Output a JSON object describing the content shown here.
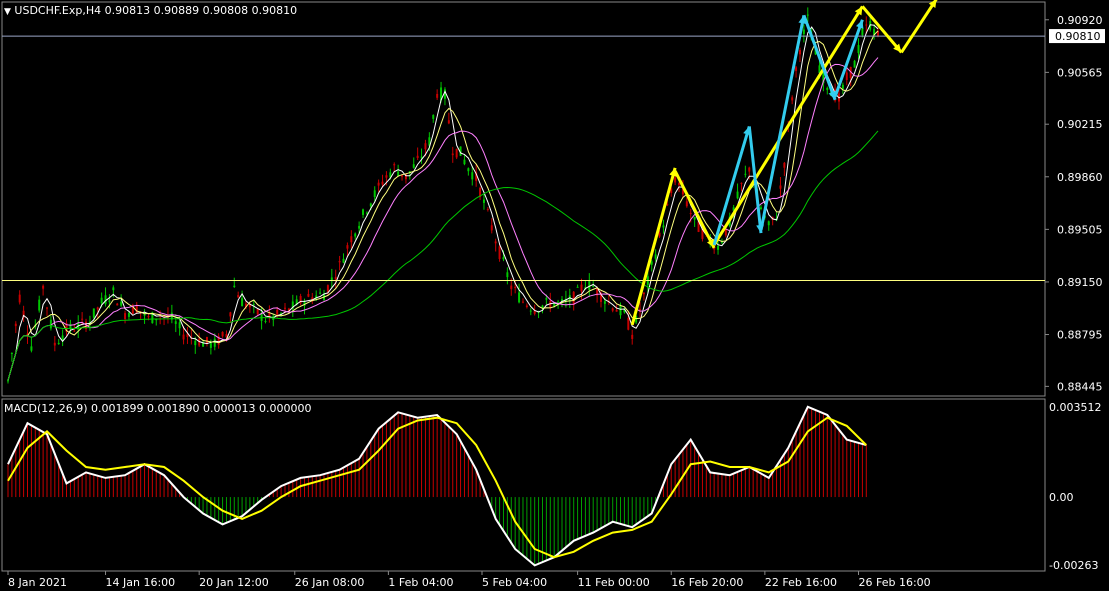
{
  "header": {
    "symbol_line": "USDCHF.Exp,H4  0.90813 0.90889 0.90808 0.90810",
    "macd_line": "MACD(12,26,9) 0.001899 0.001890 0.000013 0.000000"
  },
  "colors": {
    "background": "#000000",
    "bull_candle": "#00c800",
    "bear_candle": "#c80000",
    "ma_fast": "#ffffff",
    "ma_mid": "#ffff80",
    "ma_slow": "#ff80ff",
    "ma_long": "#00c800",
    "price_line": "#9ba6c8",
    "resistance_line": "#ffff80",
    "arrow_yellow": "#ffff00",
    "arrow_cyan": "#33ccee",
    "macd_main": "#ffffff",
    "macd_signal": "#ffff00",
    "hist_pos": "#c80000",
    "hist_neg": "#00a000"
  },
  "chart_data": [
    {
      "type": "candlestick",
      "title": "USDCHF.Exp,H4",
      "ohlc_current": {
        "open": 0.90813,
        "high": 0.90889,
        "low": 0.90808,
        "close": 0.9081
      },
      "current_price_label": "0.90810",
      "ylim": [
        0.8838,
        0.9104
      ],
      "y_ticks": [
        "0.90920",
        "0.90565",
        "0.90215",
        "0.89860",
        "0.89505",
        "0.89150",
        "0.88795",
        "0.88445"
      ],
      "horizontal_line_level": 0.8916,
      "x_tick_labels": [
        "8 Jan 2021",
        "14 Jan 16:00",
        "20 Jan 12:00",
        "26 Jan 08:00",
        "1 Feb 04:00",
        "5 Feb 04:00",
        "11 Feb 00:00",
        "16 Feb 20:00",
        "22 Feb 16:00",
        "26 Feb 16:00"
      ],
      "price_path": [
        [
          0,
          0.8848
        ],
        [
          6,
          0.8905
        ],
        [
          12,
          0.8872
        ],
        [
          18,
          0.8912
        ],
        [
          24,
          0.8873
        ],
        [
          30,
          0.8883
        ],
        [
          36,
          0.8885
        ],
        [
          42,
          0.8889
        ],
        [
          48,
          0.8901
        ],
        [
          54,
          0.8908
        ],
        [
          60,
          0.8894
        ],
        [
          66,
          0.8898
        ],
        [
          72,
          0.889
        ],
        [
          78,
          0.8893
        ],
        [
          84,
          0.889
        ],
        [
          90,
          0.888
        ],
        [
          100,
          0.8874
        ],
        [
          106,
          0.8873
        ],
        [
          112,
          0.888
        ],
        [
          116,
          0.8912
        ],
        [
          120,
          0.8902
        ],
        [
          126,
          0.8896
        ],
        [
          132,
          0.889
        ],
        [
          138,
          0.8892
        ],
        [
          144,
          0.8896
        ],
        [
          150,
          0.8902
        ],
        [
          156,
          0.8905
        ],
        [
          162,
          0.8907
        ],
        [
          170,
          0.8926
        ],
        [
          176,
          0.8945
        ],
        [
          184,
          0.8965
        ],
        [
          192,
          0.8983
        ],
        [
          198,
          0.8992
        ],
        [
          204,
          0.8986
        ],
        [
          210,
          0.8996
        ],
        [
          216,
          0.901
        ],
        [
          220,
          0.9043
        ],
        [
          224,
          0.9041
        ],
        [
          228,
          0.9005
        ],
        [
          232,
          0.9002
        ],
        [
          236,
          0.8992
        ],
        [
          240,
          0.8985
        ],
        [
          246,
          0.896
        ],
        [
          252,
          0.8935
        ],
        [
          258,
          0.8912
        ],
        [
          264,
          0.8902
        ],
        [
          270,
          0.8897
        ],
        [
          278,
          0.8901
        ],
        [
          284,
          0.89
        ],
        [
          290,
          0.8904
        ],
        [
          296,
          0.8914
        ],
        [
          300,
          0.8912
        ],
        [
          304,
          0.8906
        ],
        [
          310,
          0.8899
        ],
        [
          316,
          0.8893
        ],
        [
          320,
          0.888
        ],
        [
          326,
          0.8905
        ],
        [
          332,
          0.8935
        ],
        [
          338,
          0.8965
        ],
        [
          342,
          0.8985
        ],
        [
          346,
          0.8975
        ],
        [
          352,
          0.8955
        ],
        [
          358,
          0.8945
        ],
        [
          364,
          0.8939
        ],
        [
          370,
          0.8955
        ],
        [
          376,
          0.898
        ],
        [
          380,
          0.8992
        ],
        [
          386,
          0.8965
        ],
        [
          390,
          0.8952
        ],
        [
          394,
          0.896
        ],
        [
          398,
          0.8996
        ],
        [
          402,
          0.904
        ],
        [
          406,
          0.9073
        ],
        [
          410,
          0.9092
        ],
        [
          414,
          0.9069
        ],
        [
          418,
          0.9052
        ],
        [
          422,
          0.9045
        ],
        [
          426,
          0.9038
        ],
        [
          430,
          0.9052
        ],
        [
          434,
          0.9062
        ],
        [
          438,
          0.9083
        ],
        [
          442,
          0.9089
        ],
        [
          446,
          0.9081
        ]
      ]
    },
    {
      "type": "line",
      "title": "MACD(12,26,9)",
      "values": {
        "macd": 0.001899,
        "signal": 0.00189,
        "histogram": 1.3e-05,
        "extra": 0.0
      },
      "ylim": [
        -0.00263,
        0.003512
      ],
      "y_ticks": [
        "0.003512",
        "0.00",
        "-0.00263"
      ],
      "series": [
        {
          "name": "MACD",
          "points": [
            [
              0,
              0.0012
            ],
            [
              10,
              0.0027
            ],
            [
              20,
              0.0023
            ],
            [
              30,
              0.0005
            ],
            [
              40,
              0.0009
            ],
            [
              50,
              0.0007
            ],
            [
              60,
              0.0008
            ],
            [
              70,
              0.0012
            ],
            [
              80,
              0.0008
            ],
            [
              90,
              0.0
            ],
            [
              100,
              -0.0006
            ],
            [
              110,
              -0.001
            ],
            [
              120,
              -0.0007
            ],
            [
              130,
              -0.0001
            ],
            [
              140,
              0.0004
            ],
            [
              150,
              0.0007
            ],
            [
              160,
              0.0008
            ],
            [
              170,
              0.001
            ],
            [
              180,
              0.0014
            ],
            [
              190,
              0.0025
            ],
            [
              200,
              0.0031
            ],
            [
              210,
              0.0029
            ],
            [
              220,
              0.003
            ],
            [
              230,
              0.0023
            ],
            [
              240,
              0.001
            ],
            [
              250,
              -0.0008
            ],
            [
              260,
              -0.0019
            ],
            [
              270,
              -0.0025
            ],
            [
              280,
              -0.0022
            ],
            [
              290,
              -0.0016
            ],
            [
              300,
              -0.0013
            ],
            [
              310,
              -0.0009
            ],
            [
              320,
              -0.0011
            ],
            [
              330,
              -0.0006
            ],
            [
              340,
              0.0012
            ],
            [
              350,
              0.0021
            ],
            [
              360,
              0.0009
            ],
            [
              370,
              0.0008
            ],
            [
              380,
              0.0011
            ],
            [
              390,
              0.0007
            ],
            [
              400,
              0.0018
            ],
            [
              410,
              0.0033
            ],
            [
              420,
              0.003
            ],
            [
              430,
              0.0021
            ],
            [
              440,
              0.0019
            ]
          ]
        },
        {
          "name": "Signal",
          "points": [
            [
              0,
              0.0006
            ],
            [
              10,
              0.0018
            ],
            [
              20,
              0.0024
            ],
            [
              30,
              0.0017
            ],
            [
              40,
              0.0011
            ],
            [
              50,
              0.001
            ],
            [
              60,
              0.0011
            ],
            [
              70,
              0.0012
            ],
            [
              80,
              0.0011
            ],
            [
              90,
              0.0006
            ],
            [
              100,
              0.0
            ],
            [
              110,
              -0.0005
            ],
            [
              120,
              -0.0008
            ],
            [
              130,
              -0.0005
            ],
            [
              140,
              0.0
            ],
            [
              150,
              0.0004
            ],
            [
              160,
              0.0006
            ],
            [
              170,
              0.0008
            ],
            [
              180,
              0.001
            ],
            [
              190,
              0.0017
            ],
            [
              200,
              0.0025
            ],
            [
              210,
              0.0028
            ],
            [
              220,
              0.0029
            ],
            [
              230,
              0.0027
            ],
            [
              240,
              0.0019
            ],
            [
              250,
              0.0006
            ],
            [
              260,
              -0.0009
            ],
            [
              270,
              -0.0019
            ],
            [
              280,
              -0.0022
            ],
            [
              290,
              -0.002
            ],
            [
              300,
              -0.0016
            ],
            [
              310,
              -0.0013
            ],
            [
              320,
              -0.0012
            ],
            [
              330,
              -0.0009
            ],
            [
              340,
              0.0001
            ],
            [
              350,
              0.0012
            ],
            [
              360,
              0.0013
            ],
            [
              370,
              0.0011
            ],
            [
              380,
              0.0011
            ],
            [
              390,
              0.0009
            ],
            [
              400,
              0.0013
            ],
            [
              410,
              0.0024
            ],
            [
              420,
              0.0029
            ],
            [
              430,
              0.0026
            ],
            [
              440,
              0.0019
            ]
          ]
        }
      ]
    }
  ]
}
